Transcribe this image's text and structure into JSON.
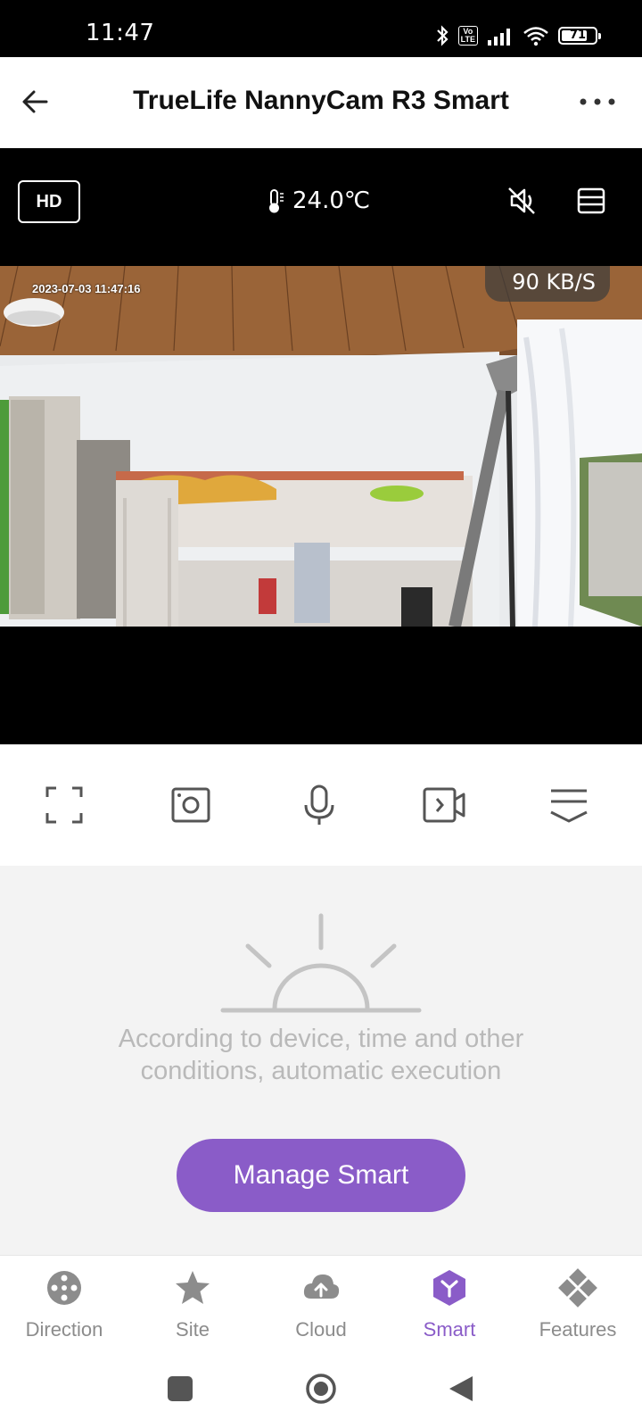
{
  "status_bar": {
    "time": "11:47",
    "battery": "71",
    "volte_label": "Vo LTE"
  },
  "header": {
    "title": "TrueLife NannyCam R3 Smart"
  },
  "video": {
    "quality_label": "HD",
    "temperature": "24.0℃",
    "timestamp": "2023-07-03 11:47:16",
    "bitrate": "90 KB/S"
  },
  "smart": {
    "description_line1": "According to device, time and other",
    "description_line2": "conditions, automatic execution",
    "manage_button": "Manage Smart"
  },
  "tabs": [
    {
      "label": "Direction",
      "icon": "joystick-icon",
      "active": false
    },
    {
      "label": "Site",
      "icon": "star-icon",
      "active": false
    },
    {
      "label": "Cloud",
      "icon": "cloud-upload-icon",
      "active": false
    },
    {
      "label": "Smart",
      "icon": "smart-hexagon-icon",
      "active": true
    },
    {
      "label": "Features",
      "icon": "features-grid-icon",
      "active": false
    }
  ],
  "colors": {
    "accent": "#8a5cc8",
    "inactive": "#8c8c8c",
    "panel_bg": "#f3f3f3"
  }
}
